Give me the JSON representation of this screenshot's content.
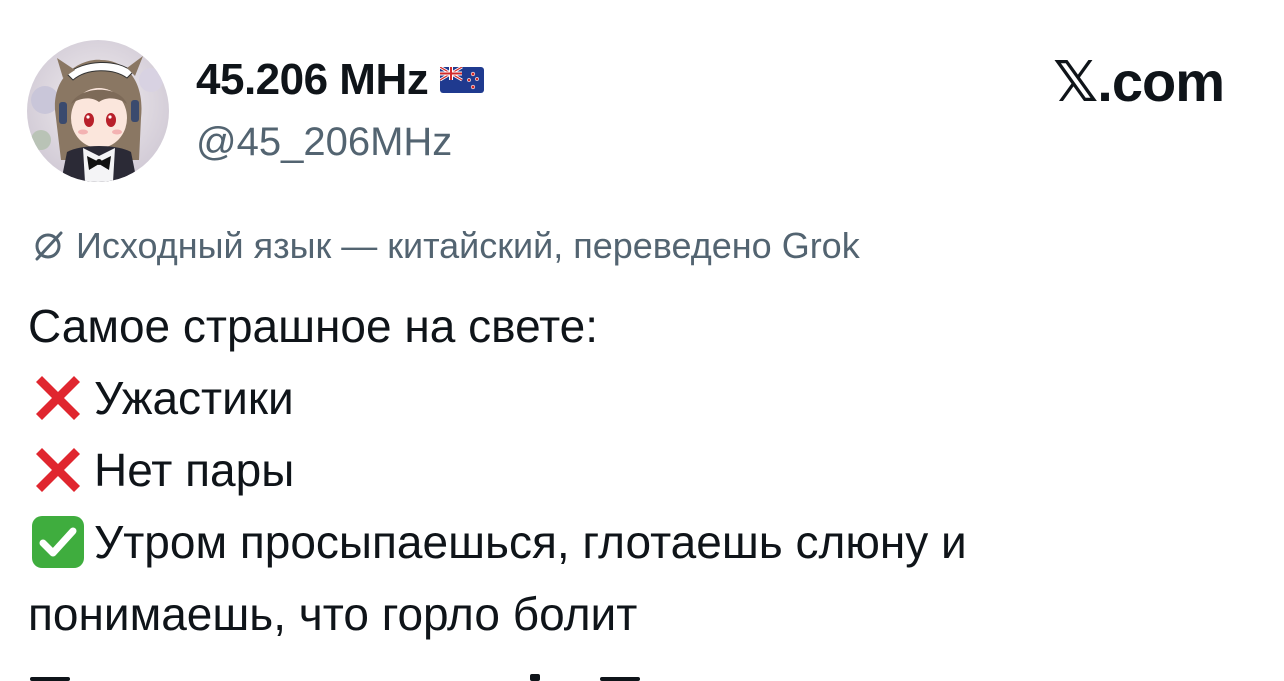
{
  "author": {
    "display_name": "45.206 MHz",
    "handle": "@45_206MHz",
    "verified_flag": "new-zealand-flag-icon"
  },
  "brand": {
    "label": "𝕏.com",
    "icon": "x-logo-icon"
  },
  "translation": {
    "icon": "translate-icon",
    "note": "Исходный язык — китайский, переведено Grok"
  },
  "tweet": {
    "lines": [
      {
        "emoji": null,
        "text": "Самое страшное на свете:"
      },
      {
        "emoji": "cross-mark-icon",
        "text": "Ужастики"
      },
      {
        "emoji": "cross-mark-icon",
        "text": "Нет пары"
      },
      {
        "emoji": "check-mark-icon",
        "text": "Утром просыпаешься, глотаешь слюну и"
      },
      {
        "emoji": null,
        "text": "понимаешь, что горло болит"
      }
    ]
  },
  "colors": {
    "text_primary": "#0f1419",
    "text_secondary": "#536471",
    "cross_red": "#e0262f",
    "check_green": "#3fad3e"
  }
}
